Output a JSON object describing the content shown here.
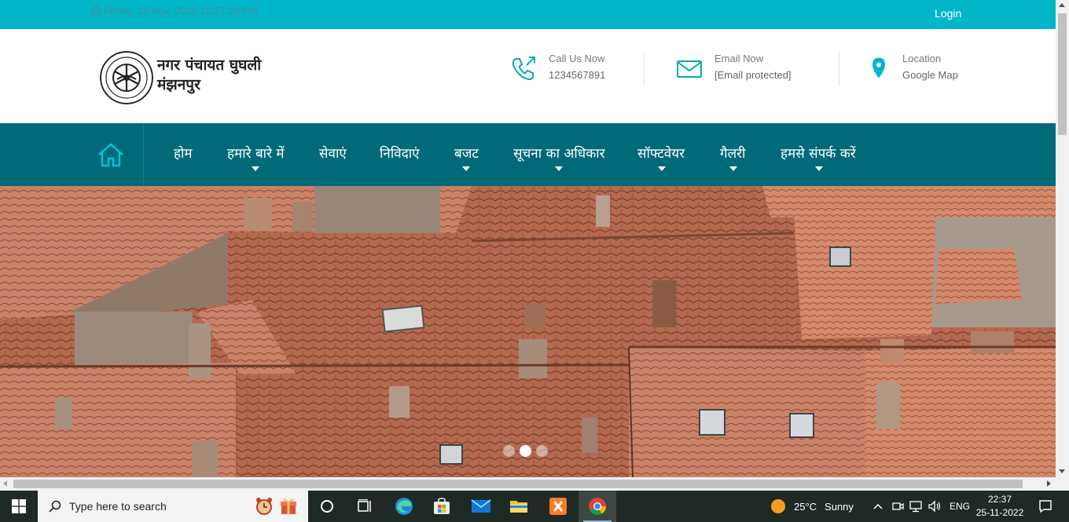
{
  "topbar": {
    "datetime": "Friday, 25 Nov, 2022 10:37:29 PM",
    "login_label": "Login"
  },
  "header": {
    "title_line1": "नगर पंचायत घुघली",
    "title_line2": "मंझनपुर",
    "contacts": [
      {
        "label": "Call Us Now",
        "value": "1234567891",
        "icon": "phone-icon"
      },
      {
        "label": "Email Now",
        "value": "[Email protected]",
        "icon": "mail-icon"
      },
      {
        "label": "Location",
        "value": "Google Map",
        "icon": "map-pin-icon"
      }
    ]
  },
  "nav": {
    "items": [
      {
        "label": "होम",
        "has_dropdown": false
      },
      {
        "label": "हमारे बारे में",
        "has_dropdown": true
      },
      {
        "label": "सेवाएं",
        "has_dropdown": false
      },
      {
        "label": "निविदाएं",
        "has_dropdown": false
      },
      {
        "label": "बजट",
        "has_dropdown": true
      },
      {
        "label": "सूचना का अधिकार",
        "has_dropdown": true
      },
      {
        "label": "सॉफ्टवेयर",
        "has_dropdown": true
      },
      {
        "label": "गैलरी",
        "has_dropdown": true
      },
      {
        "label": "हमसे संपर्क करें",
        "has_dropdown": true
      }
    ]
  },
  "slider": {
    "dots": 3,
    "active_index": 1
  },
  "taskbar": {
    "search_placeholder": "Type here to search",
    "weather_temp": "25°C",
    "weather_text": "Sunny",
    "language": "ENG",
    "time": "22:37",
    "date": "25-11-2022"
  },
  "colors": {
    "topbar": "#00b6c8",
    "nav": "#006a78",
    "accent": "#00b6c8",
    "taskbar": "#1f2a24"
  }
}
